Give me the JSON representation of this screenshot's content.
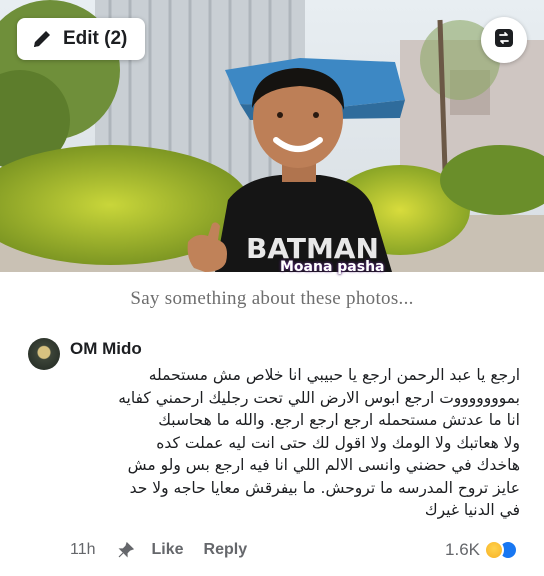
{
  "photo": {
    "edit_label": "Edit (2)",
    "watermark": "Moana pasha",
    "shirt_text": "BATMAN"
  },
  "caption_placeholder": "Say something about these photos...",
  "comment": {
    "author": "OM Mido",
    "lines": [
      "ارجع يا عبد الرحمن ارجع يا حبيبي انا خلاص مش مستحمله",
      "بموووووووت ارجع ابوس الارض اللي تحت رجليك ارحمني كفايه",
      "انا ما عدتش مستحمله ارجع ارجع ارجع. والله ما هحاسبك",
      "ولا هعاتبك ولا الومك ولا اقول لك حتى انت ليه عملت كده",
      "هاخدك في حضني وانسى الالم اللي انا فيه ارجع بس ولو مش",
      "عايز تروح المدرسه ما تروحش. ما بيفرقش معايا حاجه ولا حد",
      "في الدنيا غيرك"
    ],
    "time": "11h",
    "like_label": "Like",
    "reply_label": "Reply",
    "reaction_count": "1.6K"
  },
  "icons": {
    "edit": "pencil-icon",
    "swap": "swap-photo-icon",
    "pin": "pin-icon",
    "reactions": [
      "sad-reaction-icon",
      "like-reaction-icon"
    ]
  },
  "colors": {
    "like_blue": "#1877f2",
    "meta_gray": "#65676b",
    "caption_gray": "#6e6e6e"
  }
}
